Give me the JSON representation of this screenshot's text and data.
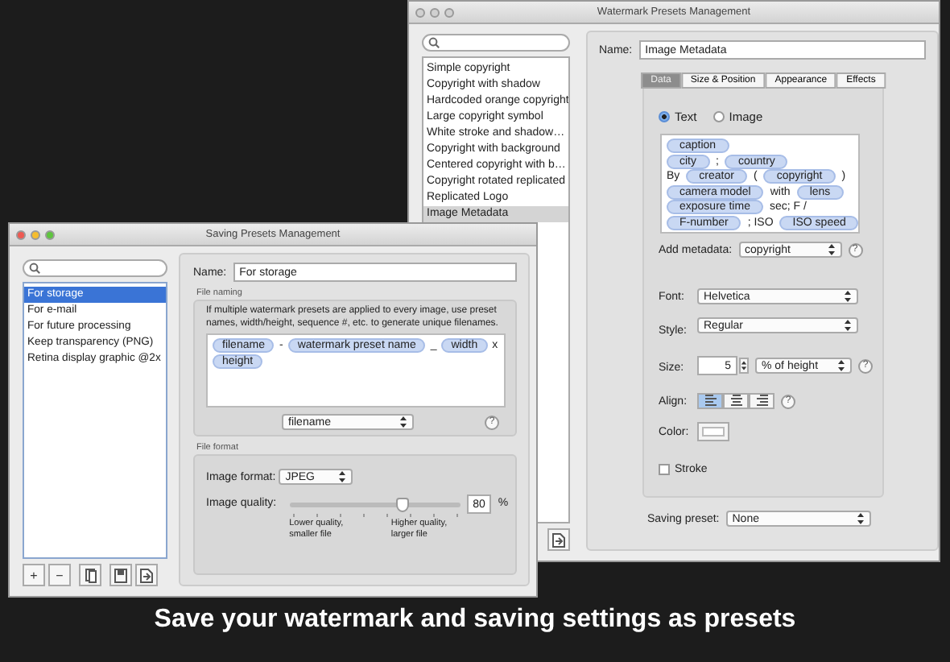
{
  "watermark_window": {
    "title": "Watermark Presets Management",
    "active": false,
    "presets": [
      {
        "label": "Simple copyright",
        "selected": false
      },
      {
        "label": "Copyright with shadow",
        "selected": false
      },
      {
        "label": "Hardcoded orange copyright",
        "selected": false
      },
      {
        "label": "Large copyright symbol",
        "selected": false
      },
      {
        "label": "White stroke and shadow…",
        "selected": false
      },
      {
        "label": "Copyright with background",
        "selected": false
      },
      {
        "label": "Centered copyright with b…",
        "selected": false
      },
      {
        "label": "Copyright rotated replicated",
        "selected": false
      },
      {
        "label": "Replicated Logo",
        "selected": false
      },
      {
        "label": "Image Metadata",
        "selected": true
      }
    ],
    "list_buttons": [
      {
        "kind": "import"
      }
    ],
    "name": {
      "label": "Name:",
      "value": "Image Metadata"
    },
    "tabs": [
      {
        "label": "Data",
        "selected": true
      },
      {
        "label": "Size & Position",
        "selected": false
      },
      {
        "label": "Appearance",
        "selected": false
      },
      {
        "label": "Effects",
        "selected": false
      }
    ],
    "source": [
      {
        "label": "Text",
        "selected": true
      },
      {
        "label": "Image",
        "selected": false
      }
    ],
    "template_lines": [
      [
        {
          "kind": "token",
          "text": "caption"
        }
      ],
      [
        {
          "kind": "token",
          "text": "city"
        },
        {
          "kind": "text",
          "text": ";"
        },
        {
          "kind": "token",
          "text": "country"
        }
      ],
      [
        {
          "kind": "text",
          "text": "By"
        },
        {
          "kind": "token",
          "text": "creator"
        },
        {
          "kind": "text",
          "text": "("
        },
        {
          "kind": "token",
          "text": "copyright"
        },
        {
          "kind": "text",
          "text": ")"
        }
      ],
      [
        {
          "kind": "token",
          "text": "camera model"
        },
        {
          "kind": "text",
          "text": "with"
        },
        {
          "kind": "token",
          "text": "lens"
        }
      ],
      [
        {
          "kind": "token",
          "text": "exposure time"
        },
        {
          "kind": "text",
          "text": "sec;  F /"
        }
      ],
      [
        {
          "kind": "token",
          "text": "F-number"
        },
        {
          "kind": "text",
          "text": "; ISO"
        },
        {
          "kind": "token",
          "text": "ISO speed"
        }
      ]
    ],
    "add_metadata": {
      "label": "Add metadata:",
      "value": "copyright",
      "help": "?"
    },
    "font": {
      "label": "Font:",
      "value": "Helvetica"
    },
    "style": {
      "label": "Style:",
      "value": "Regular"
    },
    "size": {
      "label": "Size:",
      "value": "5",
      "unit": "% of height",
      "help": "?"
    },
    "align": {
      "label": "Align:",
      "options": [
        {
          "kind": "left",
          "selected": true
        },
        {
          "kind": "center",
          "selected": false
        },
        {
          "kind": "right",
          "selected": false
        }
      ],
      "help": "?"
    },
    "color": {
      "label": "Color:",
      "color": "#ffffff"
    },
    "stroke": {
      "label": "Stroke",
      "checked": false
    },
    "saving_preset": {
      "label": "Saving preset:",
      "value": "None"
    }
  },
  "saving_window": {
    "title": "Saving Presets Management",
    "active": true,
    "presets": [
      {
        "label": "For storage",
        "selected": true
      },
      {
        "label": "For e-mail",
        "selected": false
      },
      {
        "label": "For future processing",
        "selected": false
      },
      {
        "label": "Keep transparency (PNG)",
        "selected": false
      },
      {
        "label": "Retina display graphic @2x",
        "selected": false
      }
    ],
    "list_buttons": [
      {
        "kind": "add",
        "label": "+"
      },
      {
        "kind": "remove",
        "label": "−"
      },
      {
        "kind": "duplicate"
      },
      {
        "kind": "export"
      },
      {
        "kind": "import"
      }
    ],
    "name": {
      "label": "Name:",
      "value": "For storage"
    },
    "file_naming": {
      "title": "File naming",
      "description": "If multiple watermark presets are applied to every image, use preset names, width/height, sequence #, etc. to generate unique filenames.",
      "template_lines": [
        [
          {
            "kind": "token",
            "text": "filename"
          },
          {
            "kind": "text",
            "text": "-"
          },
          {
            "kind": "token",
            "text": "watermark preset name"
          },
          {
            "kind": "text",
            "text": "_"
          },
          {
            "kind": "token",
            "text": "width"
          },
          {
            "kind": "text",
            "text": "x"
          }
        ],
        [
          {
            "kind": "token",
            "text": "height"
          }
        ]
      ],
      "insert": {
        "value": "filename",
        "help": "?"
      }
    },
    "file_format": {
      "title": "File format",
      "format": {
        "label": "Image format:",
        "value": "JPEG"
      },
      "quality": {
        "label": "Image quality:",
        "level": 0.66,
        "value": "80",
        "unit": "%",
        "low_hint": "Lower quality,\nsmaller file",
        "high_hint": "Higher quality,\nlarger file"
      }
    }
  },
  "caption": "Save your watermark and saving settings as presets"
}
